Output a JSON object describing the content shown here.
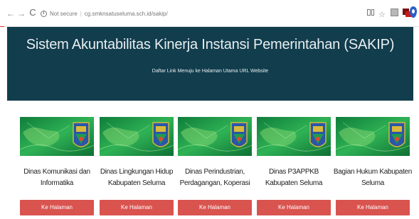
{
  "browser": {
    "security_label": "Not secure",
    "url": "cg.smknsatuseluma.sch.id/sakip/"
  },
  "header": {
    "title": "Sistem Akuntabilitas Kinerja Instansi Pemerintahan (SAKIP)",
    "subtitle": "Daftar Link Menuju ke Halaman Utama URL Website"
  },
  "colors": {
    "banner": "#113d4d",
    "button": "#d9534f",
    "thumbnail_green": "#1fa04a"
  },
  "cards": [
    {
      "name_line1": "Dinas Komunikasi dan",
      "name_line2": "Informatika",
      "button_label": "Ke Halaman"
    },
    {
      "name_line1": "Dinas Lingkungan Hidup",
      "name_line2": "Kabupaten Seluma",
      "button_label": "Ke Halaman"
    },
    {
      "name_line1": "Dinas Perindustrian,",
      "name_line2": "Perdagangan, Koperasi",
      "button_label": "Ke Halaman"
    },
    {
      "name_line1": "Dinas P3APPKB",
      "name_line2": "Kabupaten Seluma",
      "button_label": "Ke Halaman"
    },
    {
      "name_line1": "Bagian Hukum Kabupaten",
      "name_line2": "Seluma",
      "button_label": "Ke Halaman"
    }
  ]
}
